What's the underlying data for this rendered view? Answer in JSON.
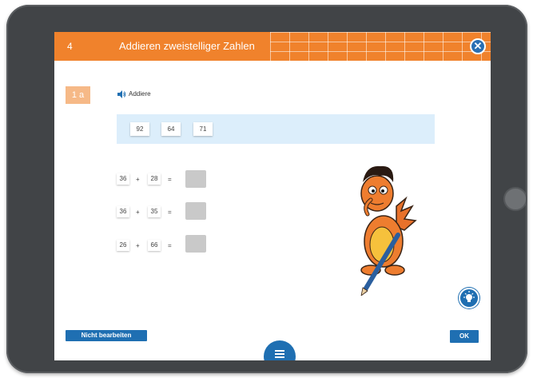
{
  "header": {
    "lesson_number": "4",
    "title": "Addieren zweistelliger Zahlen"
  },
  "task": {
    "badge": "1 a",
    "instruction": "Addiere"
  },
  "choices": [
    "92",
    "64",
    "71"
  ],
  "equations": [
    {
      "a": "36",
      "op": "+",
      "b": "28",
      "eq": "="
    },
    {
      "a": "36",
      "op": "+",
      "b": "35",
      "eq": "="
    },
    {
      "a": "26",
      "op": "+",
      "b": "66",
      "eq": "="
    }
  ],
  "footer": {
    "skip_label": "Nicht bearbeiten",
    "ok_label": "OK"
  },
  "colors": {
    "header_orange": "#f0822c",
    "accent_blue": "#1f6fb2",
    "choice_band": "#dceefb",
    "answer_box": "#c9c9c9"
  },
  "icons": [
    "close-icon",
    "speaker-icon",
    "hint-lightbulb-icon",
    "menu-icon"
  ]
}
